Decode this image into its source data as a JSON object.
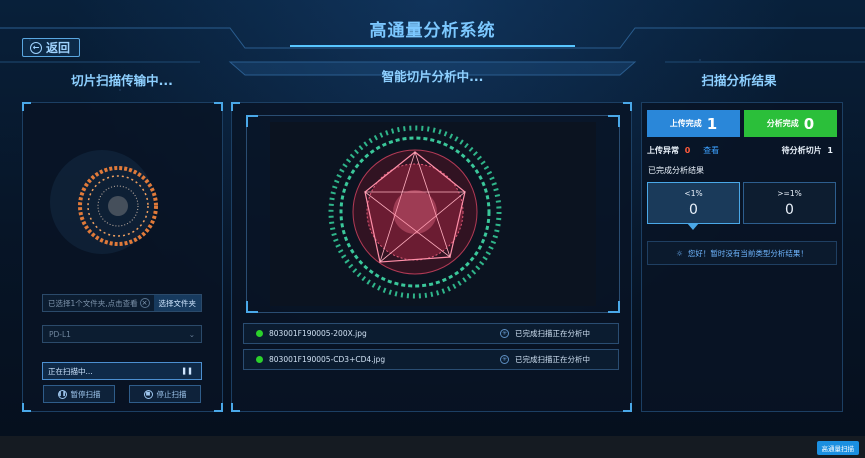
{
  "app": {
    "title": "高通量分析系统",
    "back_label": "返回"
  },
  "sections": {
    "left_title": "切片扫描传输中...",
    "center_title": "智能切片分析中...",
    "right_title": "扫描分析结果"
  },
  "left_panel": {
    "file_placeholder": "已选择1个文件夹,点击查看",
    "choose_folder_label": "选择文件夹",
    "select_value": "PD-L1",
    "progress_text": "正在扫描中...",
    "pause_label": "暂停扫描",
    "stop_label": "停止扫描"
  },
  "center_panel": {
    "files": [
      {
        "name": "803001F190005-200X.jpg",
        "status": "已完成扫描正在分析中"
      },
      {
        "name": "803001F190005-CD3+CD4.jpg",
        "status": "已完成扫描正在分析中"
      }
    ]
  },
  "right_panel": {
    "upload_done_label": "上传完成",
    "upload_done_count": "1",
    "analysis_done_label": "分析完成",
    "analysis_done_count": "0",
    "upload_error_label": "上传异常",
    "upload_error_count": "0",
    "view_label": "查看",
    "pending_label": "待分析切片",
    "pending_count": "1",
    "completed_label": "已完成分析结果",
    "results": [
      {
        "label": "<1%",
        "value": "0"
      },
      {
        "label": ">=1%",
        "value": "0"
      }
    ],
    "notice": "您好！暂时没有当前类型分析结果！"
  },
  "footer": {
    "scan_button_label": "高通量扫描"
  },
  "colors": {
    "upload_btn": "#2a87d9",
    "analysis_btn": "#2bbf3a",
    "error_count": "#ff5a3c",
    "link": "#3da1ff",
    "status_green": "#2bd12b"
  }
}
